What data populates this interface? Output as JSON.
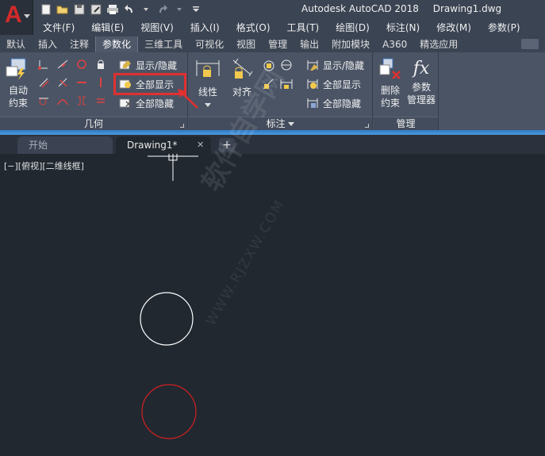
{
  "window": {
    "app_title": "Autodesk AutoCAD 2018",
    "document_title": "Drawing1.dwg"
  },
  "menus": [
    "文件(F)",
    "编辑(E)",
    "视图(V)",
    "插入(I)",
    "格式(O)",
    "工具(T)",
    "绘图(D)",
    "标注(N)",
    "修改(M)",
    "参数(P)"
  ],
  "ribbon_tabs": [
    "默认",
    "插入",
    "注释",
    "参数化",
    "三维工具",
    "可视化",
    "视图",
    "管理",
    "输出",
    "附加模块",
    "A360",
    "精选应用"
  ],
  "active_ribbon_tab": "参数化",
  "panels": {
    "geometry": {
      "title": "几何",
      "auto_constrain_label_1": "自动",
      "auto_constrain_label_2": "约束",
      "show_hide": "显示/隐藏",
      "show_all": "全部显示",
      "hide_all": "全部隐藏"
    },
    "dimension": {
      "title": "标注",
      "linear": "线性",
      "aligned": "对齐",
      "show_hide": "显示/隐藏",
      "show_all": "全部显示",
      "hide_all": "全部隐藏"
    },
    "manage": {
      "title": "管理",
      "delete_label_1": "删除",
      "delete_label_2": "约束",
      "params_label_1": "参数",
      "params_label_2": "管理器",
      "fx": "fx"
    }
  },
  "file_tabs": {
    "start": "开始",
    "drawing": "Drawing1*",
    "close": "✕",
    "new": "+"
  },
  "canvas": {
    "viewport_label": "[−][俯视][二维线框]",
    "watermark_text": "软件自学网",
    "watermark_url": "WWW.RJZXW.COM",
    "circle_colors": [
      "#ffffff",
      "#d42020"
    ]
  },
  "colors": {
    "highlight": "#e03030",
    "accent_blue": "#2f7bc4"
  }
}
